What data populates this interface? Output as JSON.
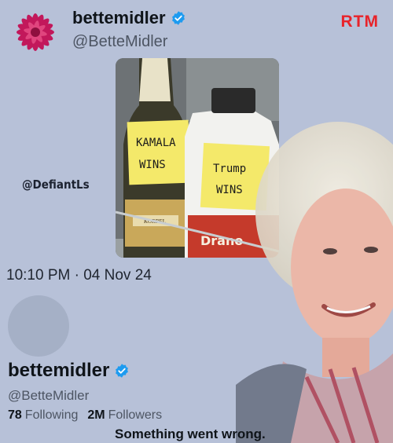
{
  "header": {
    "display_name": "bettemidler",
    "handle": "@BetteMidler",
    "verified_icon": "verified-badge-icon",
    "brand_logo": "RTM"
  },
  "photo": {
    "left_bottle_brand": "KORBEL",
    "left_note": [
      "KAMALA",
      "WINS"
    ],
    "right_note": [
      "Trump",
      "WINS"
    ],
    "right_bottle_label": "Drano"
  },
  "watermark": "@DefiantLs",
  "timestamp": "10:10 PM · 04 Nov 24",
  "profile_card": {
    "display_name": "bettemidler",
    "handle": "@BetteMidler",
    "following_count": "78",
    "following_label": "Following",
    "followers_count": "2M",
    "followers_label": "Followers",
    "error_message": "Something went wrong."
  },
  "colors": {
    "background": "#b7c1d8",
    "verified": "#1d9bf0",
    "brand": "#e8232a"
  }
}
